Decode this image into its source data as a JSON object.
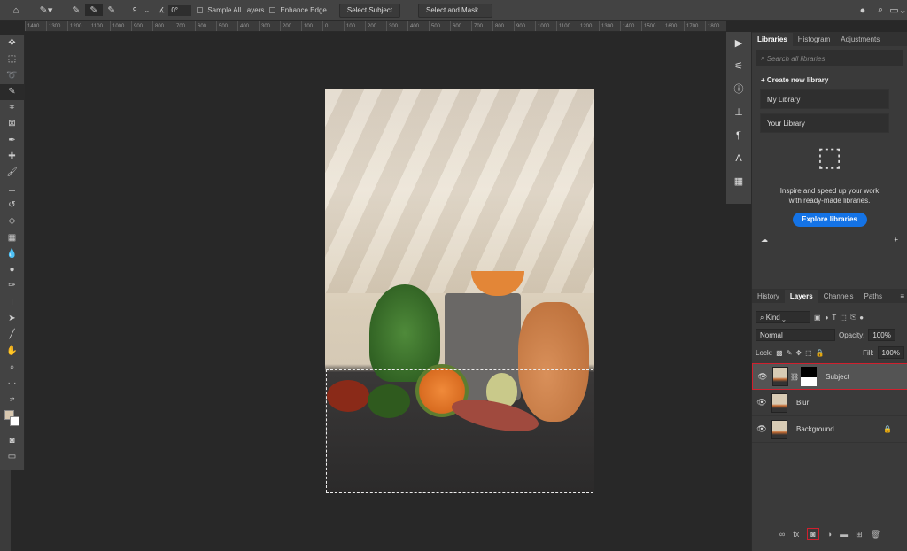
{
  "options_bar": {
    "brush_size": "9",
    "angle": "0°",
    "sample_all_layers": "Sample All Layers",
    "enhance_edge": "Enhance Edge",
    "select_subject": "Select Subject",
    "select_and_mask": "Select and Mask..."
  },
  "ruler": [
    "1400",
    "1300",
    "1200",
    "1100",
    "1000",
    "900",
    "800",
    "700",
    "600",
    "500",
    "400",
    "300",
    "200",
    "100",
    "0",
    "100",
    "200",
    "300",
    "400",
    "500",
    "600",
    "700",
    "800",
    "900",
    "1000",
    "1100",
    "1200",
    "1300",
    "1400",
    "1500",
    "1600",
    "1700",
    "1800"
  ],
  "libraries_panel": {
    "tabs": [
      "Libraries",
      "Histogram",
      "Adjustments"
    ],
    "search_placeholder": "Search all libraries",
    "create": "Create new library",
    "libraries": [
      "My Library",
      "Your Library"
    ],
    "promo": "Inspire and speed up your work with ready-made libraries.",
    "explore": "Explore libraries"
  },
  "layers_panel": {
    "tabs": [
      "History",
      "Layers",
      "Channels",
      "Paths"
    ],
    "filter": "Kind",
    "blend_mode": "Normal",
    "opacity_label": "Opacity:",
    "opacity": "100%",
    "lock_label": "Lock:",
    "fill_label": "Fill:",
    "fill": "100%",
    "layers": [
      {
        "name": "Subject",
        "selected": true,
        "mask": true
      },
      {
        "name": "Blur"
      },
      {
        "name": "Background",
        "locked": true
      }
    ]
  },
  "colors": {
    "accent": "#1473e6",
    "highlight": "#d0202e"
  }
}
